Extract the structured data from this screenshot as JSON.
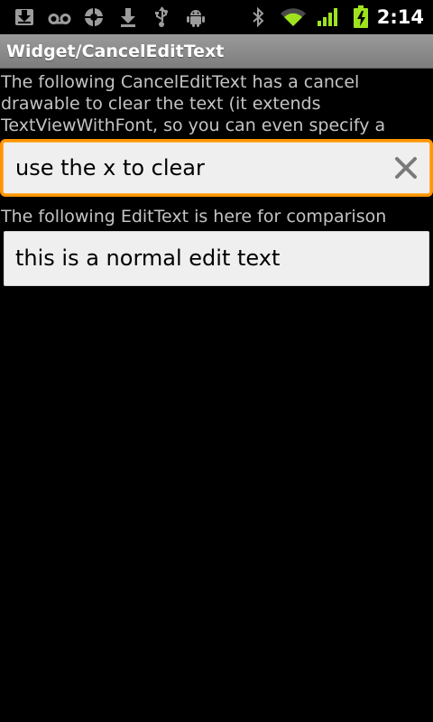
{
  "status_bar": {
    "time": "2:14",
    "left_icons": [
      "download-icon",
      "voicemail-icon",
      "sync-icon",
      "download-arrow-icon",
      "usb-icon",
      "android-debug-icon"
    ],
    "right_icons": [
      "bluetooth-icon",
      "wifi-icon",
      "signal-icon",
      "battery-charging-icon"
    ],
    "colors": {
      "status_icons": "#9c9c9c",
      "signal_bars": "#9fe31f",
      "battery": "#9fe31f"
    }
  },
  "title_bar": {
    "title": "Widget/CancelEditText"
  },
  "main": {
    "description_1": "The following CancelEditText has a cancel drawable to clear the text (it extends TextViewWithFont, so you can even specify a custom font if you like)",
    "cancel_edit": {
      "value": "use the x to clear",
      "clear_icon": "close-icon",
      "focus_color": "#ff9500"
    },
    "description_2": "The following EditText is here for comparison",
    "normal_edit": {
      "value": "this is a normal edit text"
    }
  }
}
